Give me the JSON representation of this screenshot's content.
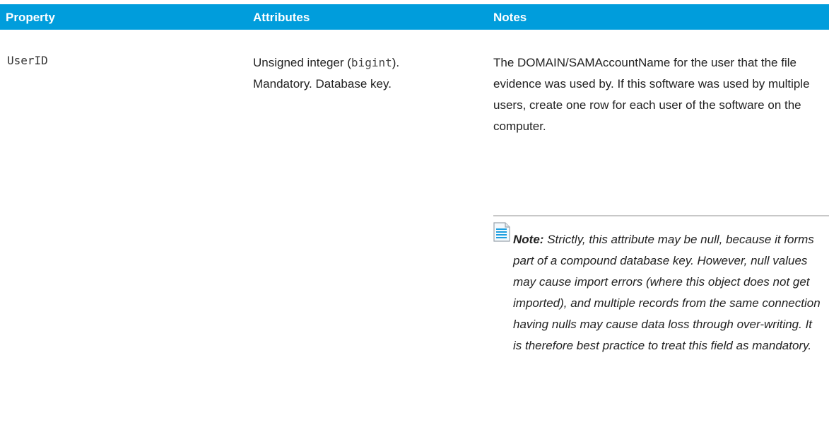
{
  "table": {
    "headers": {
      "property": "Property",
      "attributes": "Attributes",
      "notes": "Notes"
    },
    "rows": [
      {
        "property": "UserID",
        "attributes": {
          "prefix": "Unsigned integer (",
          "code": "bigint",
          "suffix": ").",
          "line2": "Mandatory. Database key."
        },
        "notes": "The DOMAIN/SAMAccountName for the user that the file evidence was used by. If this software was used by multiple users, create one row for each user of the software on the computer.",
        "note": {
          "label": "Note:",
          "text": "Strictly, this attribute may be null, because it forms part of a compound database key. However, null values may cause import errors (where this object does not get imported), and multiple records from the same connection having nulls may cause data loss through over-writing. It is therefore best practice to treat this field as mandatory.",
          "icon": "note-document-icon"
        }
      }
    ]
  },
  "colors": {
    "header_background": "#009ddc",
    "header_text": "#ffffff",
    "divider": "#c8c8c8"
  }
}
